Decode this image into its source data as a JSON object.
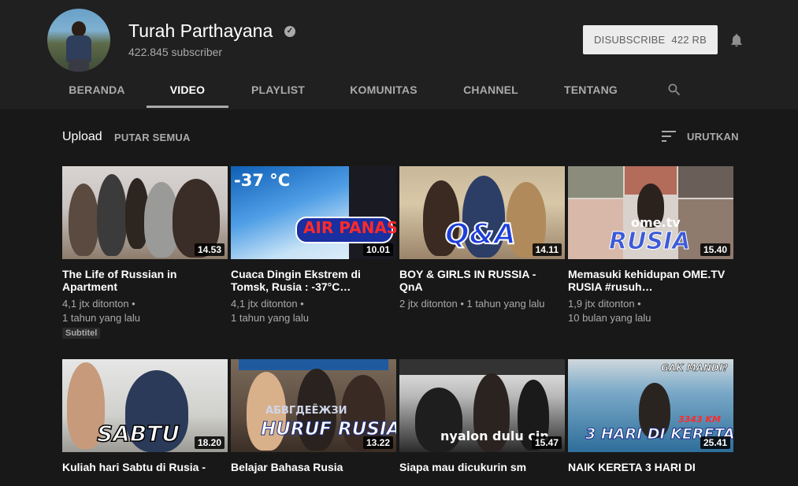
{
  "channel": {
    "name": "Turah Parthayana",
    "subscribers": "422.845 subscriber",
    "unsubscribe_label": "DISUBSCRIBE",
    "unsubscribe_count": "422 RB"
  },
  "tabs": [
    {
      "label": "BERANDA",
      "active": false
    },
    {
      "label": "VIDEO",
      "active": true
    },
    {
      "label": "PLAYLIST",
      "active": false
    },
    {
      "label": "KOMUNITAS",
      "active": false
    },
    {
      "label": "CHANNEL",
      "active": false
    },
    {
      "label": "TENTANG",
      "active": false
    }
  ],
  "section": {
    "title": "Upload",
    "play_all": "PUTAR SEMUA",
    "sort_label": "URUTKAN"
  },
  "videos": [
    {
      "title": "The Life of Russian in Apartment",
      "duration": "14.53",
      "views": "4,1 jtx ditonton",
      "age": "1 tahun yang lalu",
      "badge": "Subtitel",
      "overlay": ""
    },
    {
      "title": "Cuaca Dingin Ekstrem di Tomsk, Rusia : -37°C…",
      "duration": "10.01",
      "views": "4,1 jtx ditonton",
      "age": "1 tahun yang lalu",
      "badge": "",
      "overlay": "AIR PANAS",
      "overlay2": "-37 °C"
    },
    {
      "title": "BOY & GIRLS IN RUSSIA - QnA",
      "duration": "14.11",
      "views": "2 jtx ditonton",
      "age": "1 tahun yang lalu",
      "badge": "",
      "overlay": "Q&A"
    },
    {
      "title": "Memasuki kehidupan OME.TV RUSIA #rusuh…",
      "duration": "15.40",
      "views": "1,9 jtx ditonton",
      "age": "10 bulan yang lalu",
      "badge": "",
      "overlay": "RUSIA",
      "overlay2": "ome.tv"
    },
    {
      "title": "Kuliah hari Sabtu di Rusia -",
      "duration": "18.20",
      "views": "",
      "age": "",
      "badge": "",
      "overlay": "SABTU"
    },
    {
      "title": "Belajar Bahasa Rusia",
      "duration": "13.22",
      "views": "",
      "age": "",
      "badge": "",
      "overlay": "HURUF RUSIA",
      "overlay2": "АБВГДЕЁЖЗИ"
    },
    {
      "title": "Siapa mau dicukurin sm",
      "duration": "15.47",
      "views": "",
      "age": "",
      "badge": "",
      "overlay": "nyalon dulu cin"
    },
    {
      "title": "NAIK KERETA 3 HARI DI",
      "duration": "25.41",
      "views": "",
      "age": "",
      "badge": "",
      "overlay": "3 HARI DI KERETA",
      "overlay2": "GAK MANDI?",
      "overlay3": "3343 KM"
    }
  ],
  "colors": {
    "background": "#181818",
    "header": "#202020",
    "text_secondary": "#aaaaaa"
  },
  "icons": [
    "verified-icon",
    "bell-icon",
    "search-icon",
    "sort-icon"
  ]
}
